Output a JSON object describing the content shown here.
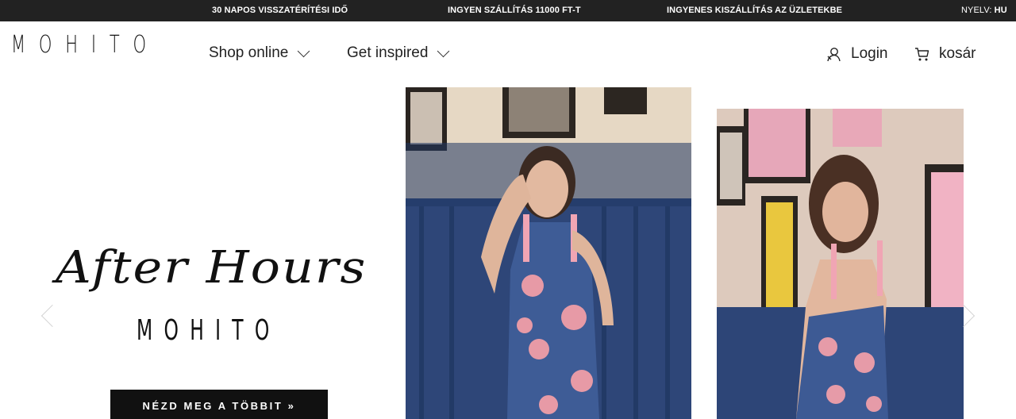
{
  "topbar": {
    "promo_1": "30 NAPOS VISSZATÉRÍTÉSI IDŐ",
    "promo_2": "INGYEN SZÁLLÍTÁS 11000 FT-T",
    "promo_3": "INGYENES KISZÁLLÍTÁS AZ ÜZLETEKBE",
    "language_label": "NYELV:",
    "language_value": "HU",
    "background_color": "#222222"
  },
  "header": {
    "logo": "MOHITO",
    "nav": [
      {
        "label": "Shop online",
        "icon": "chevron-down-icon"
      },
      {
        "label": "Get inspired",
        "icon": "chevron-down-icon"
      }
    ],
    "login_label": "Login",
    "login_icon": "user-icon",
    "cart_label": "kosár",
    "cart_icon": "cart-icon"
  },
  "hero": {
    "script_title": "After Hours",
    "brand": "MOHITO",
    "cta_label": "NÉZD MEG A TÖBBIT »",
    "prev_icon": "arrow-left-icon",
    "next_icon": "arrow-right-icon"
  }
}
